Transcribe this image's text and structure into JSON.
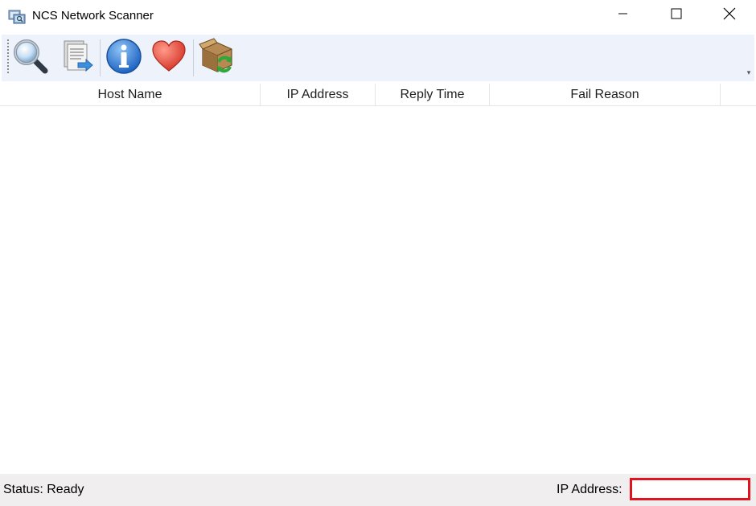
{
  "window": {
    "title": "NCS Network Scanner",
    "app_icon": "network-scanner-app-icon"
  },
  "window_controls": {
    "minimize_icon": "minimize-icon",
    "maximize_icon": "maximize-icon",
    "close_icon": "close-icon"
  },
  "toolbar": {
    "buttons": [
      {
        "icon": "magnifier-icon"
      },
      {
        "icon": "export-document-icon"
      },
      {
        "icon": "info-icon"
      },
      {
        "icon": "heart-icon"
      },
      {
        "icon": "package-refresh-icon"
      }
    ],
    "overflow_icon": "toolbar-overflow-icon",
    "overflow_glyph": "▾"
  },
  "table": {
    "columns": [
      "Host Name",
      "IP Address",
      "Reply Time",
      "Fail Reason"
    ],
    "rows": []
  },
  "statusbar": {
    "status_text": "Status:  Ready",
    "ip_label": "IP Address:",
    "ip_value": ""
  },
  "colors": {
    "toolbar_bg": "#eef3fb",
    "statusbar_bg": "#f0eeee",
    "highlight_border": "#e0141e"
  }
}
